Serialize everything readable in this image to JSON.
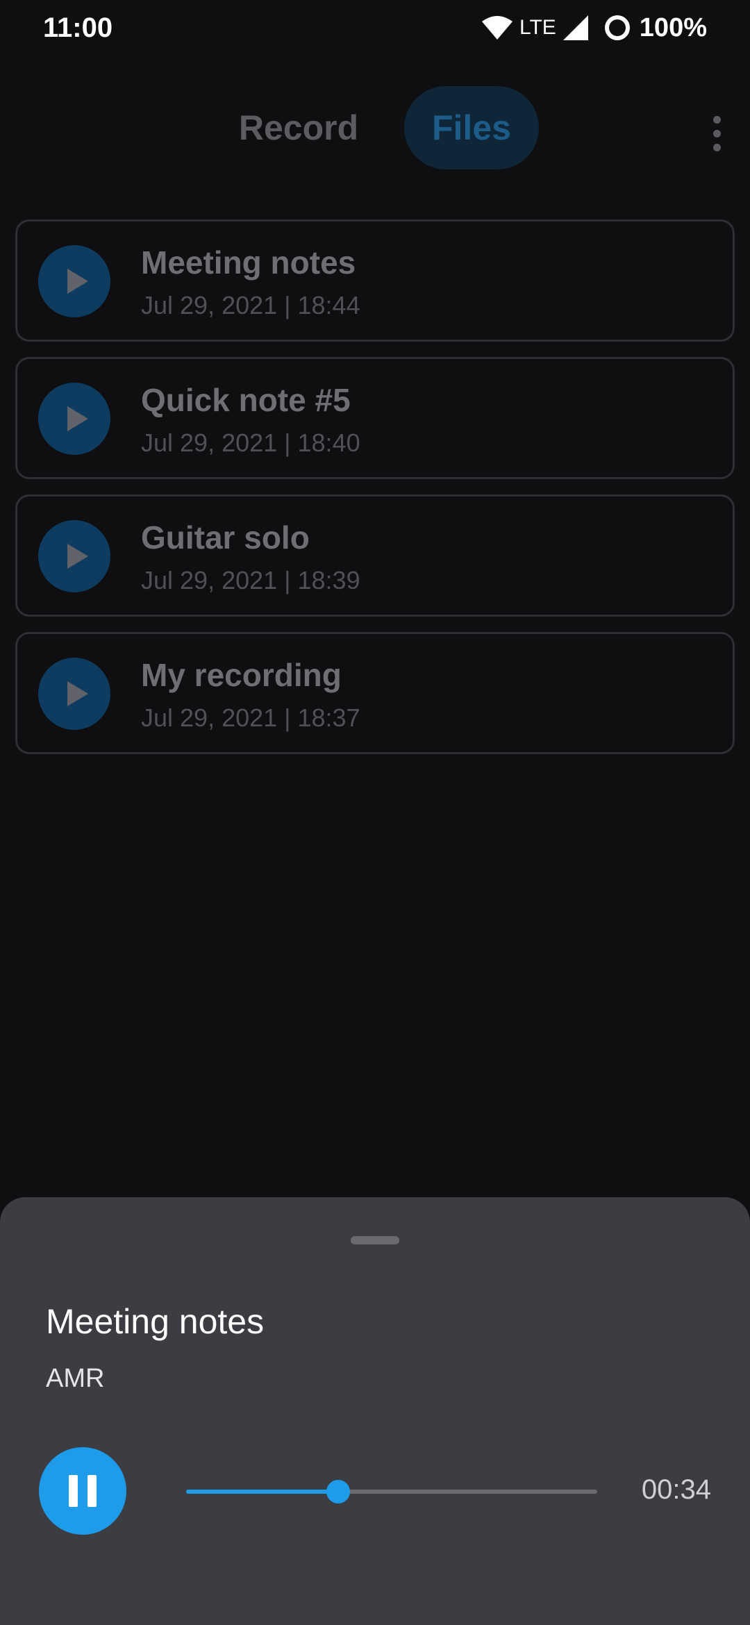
{
  "status_bar": {
    "time": "11:00",
    "network": "LTE",
    "battery": "100%",
    "icons": [
      "wifi-icon",
      "cell-signal-icon",
      "battery-ring-icon"
    ]
  },
  "tabs": {
    "record_label": "Record",
    "files_label": "Files",
    "selected": "Files",
    "more_icon": "more-vert-icon"
  },
  "files": [
    {
      "title": "Meeting notes",
      "date": "Jul 29, 2021 | 18:44"
    },
    {
      "title": "Quick note #5",
      "date": "Jul 29, 2021 | 18:40"
    },
    {
      "title": "Guitar solo",
      "date": "Jul 29, 2021 | 18:39"
    },
    {
      "title": "My recording",
      "date": "Jul 29, 2021 | 18:37"
    }
  ],
  "player": {
    "title": "Meeting notes",
    "format": "AMR",
    "time": "00:34",
    "progress": 0.37,
    "state_icon": "pause-icon"
  },
  "colors": {
    "accent": "#1e9be9",
    "background": "#0f0f11",
    "sheet": "#3c3d42"
  }
}
